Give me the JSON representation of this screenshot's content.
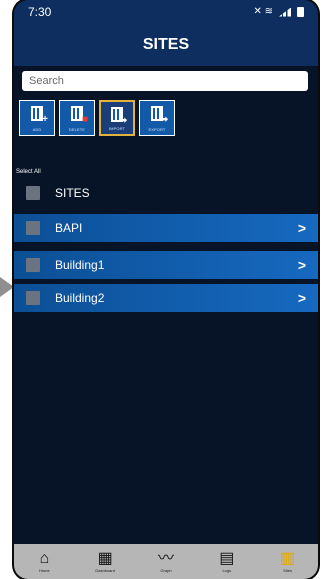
{
  "status_bar": {
    "time": "7:30"
  },
  "header": {
    "title": "SITES"
  },
  "search": {
    "placeholder": "Search"
  },
  "toolbar": {
    "add_label": "ADD",
    "delete_label": "DELETE",
    "import_label": "IMPORT",
    "export_label": "EXPORT",
    "selected": "IMPORT"
  },
  "list": {
    "select_all_label": "Select All",
    "group_label": "SITES",
    "items": [
      {
        "label": "BAPI"
      },
      {
        "label": "Building1"
      },
      {
        "label": "Building2"
      }
    ]
  },
  "bottom_nav": {
    "items": [
      {
        "label": "Home",
        "icon": "home-icon"
      },
      {
        "label": "Dashboard",
        "icon": "grid-icon"
      },
      {
        "label": "Graph",
        "icon": "graph-icon"
      },
      {
        "label": "Logs",
        "icon": "logs-icon"
      },
      {
        "label": "Sites",
        "icon": "building-icon"
      }
    ],
    "active": "Sites"
  },
  "colors": {
    "header_bg": "#0d2e5f",
    "screen_bg": "#071428",
    "row_bg": "#1669c0",
    "active_accent": "#e3a800"
  }
}
